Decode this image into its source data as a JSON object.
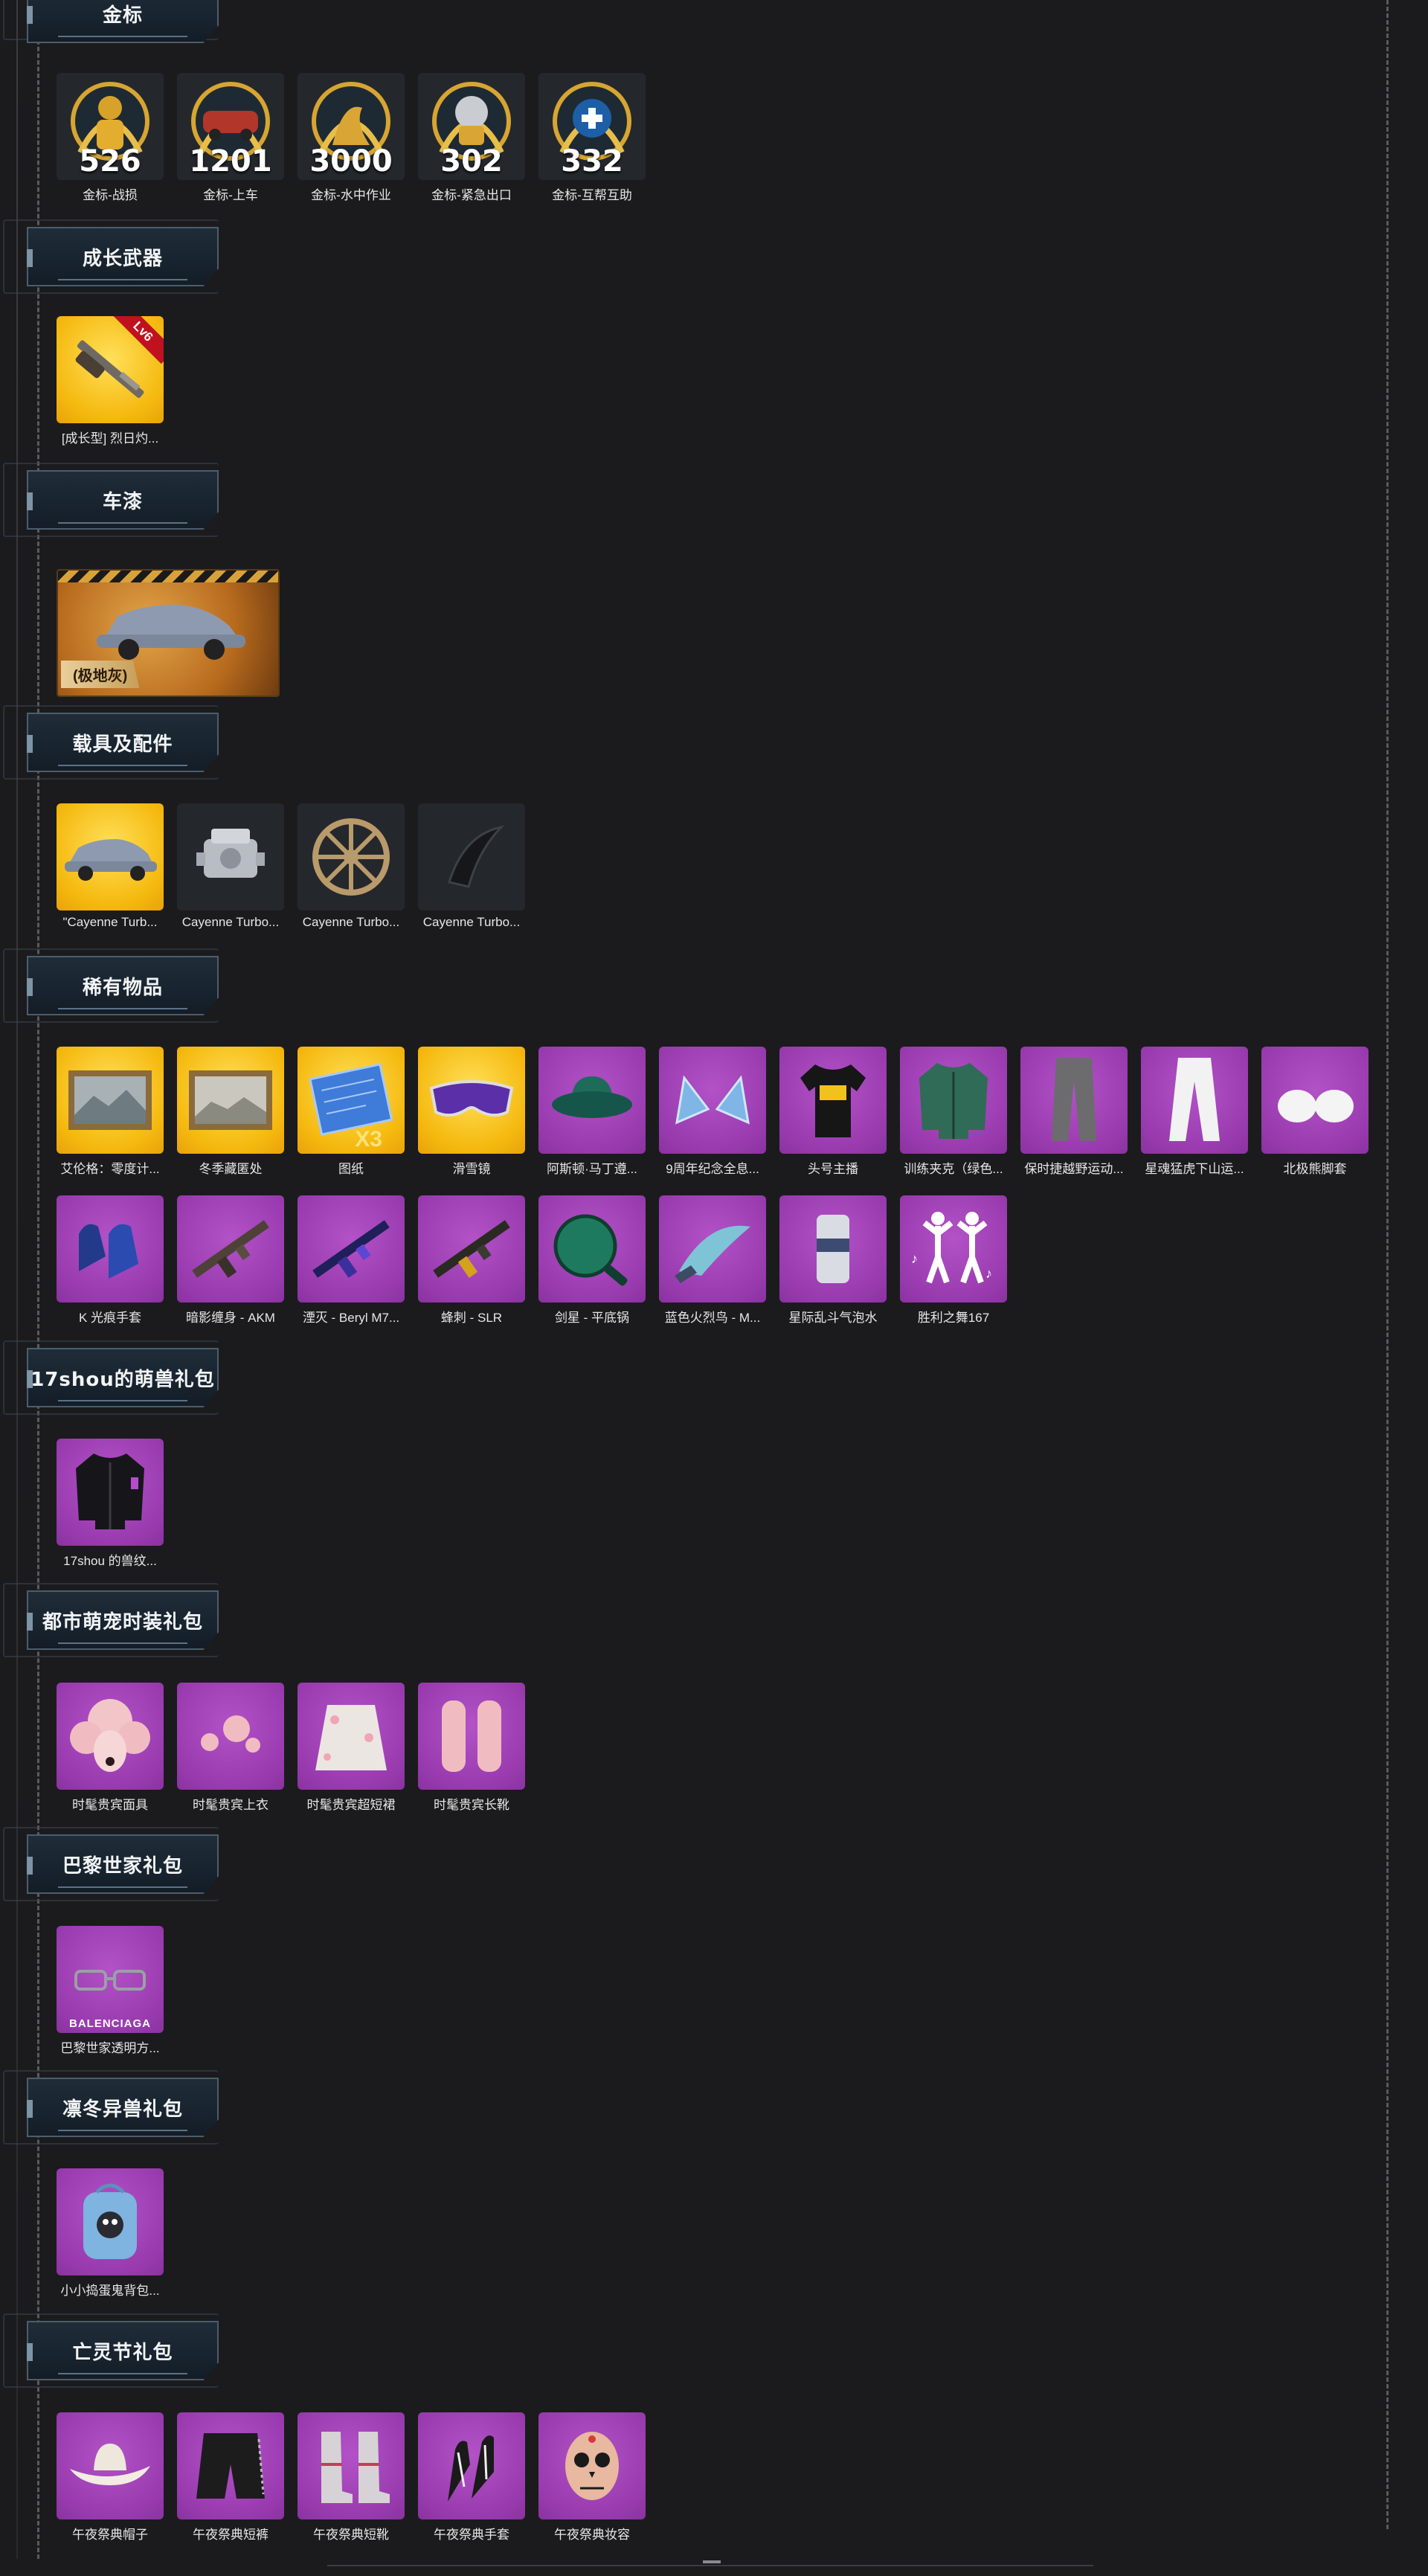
{
  "sections": {
    "gold_medals": {
      "title": "金标",
      "items": [
        {
          "count": "526",
          "label": "金标-战损",
          "icon": "gold-medal-soldier-icon"
        },
        {
          "count": "1201",
          "label": "金标-上车",
          "icon": "gold-medal-car-icon"
        },
        {
          "count": "3000",
          "label": "金标-水中作业",
          "icon": "gold-medal-seal-icon"
        },
        {
          "count": "302",
          "label": "金标-紧急出口",
          "icon": "gold-medal-parachute-icon"
        },
        {
          "count": "332",
          "label": "金标-互帮互助",
          "icon": "gold-medal-medic-icon"
        }
      ]
    },
    "growth_weapons": {
      "title": "成长武器",
      "items": [
        {
          "label": "[成长型] 烈日灼...",
          "badge": "Lv6",
          "icon": "shotgun-icon"
        }
      ]
    },
    "vehicle_skins": {
      "title": "车漆",
      "items": [
        {
          "tag": "(极地灰)",
          "icon": "suv-icon"
        }
      ]
    },
    "vehicles_parts": {
      "title": "载具及配件",
      "items": [
        {
          "label": "\"Cayenne Turb...",
          "icon": "suv-icon",
          "bg": "gold"
        },
        {
          "label": "Cayenne Turbo...",
          "icon": "engine-icon",
          "bg": "dark"
        },
        {
          "label": "Cayenne Turbo...",
          "icon": "wheel-icon",
          "bg": "dark"
        },
        {
          "label": "Cayenne Turbo...",
          "icon": "spoiler-icon",
          "bg": "dark"
        }
      ]
    },
    "rare_items": {
      "title": "稀有物品",
      "row1": [
        {
          "label": "艾伦格：零度计...",
          "icon": "painting-icon",
          "bg": "gold"
        },
        {
          "label": "冬季藏匿处",
          "icon": "painting-icon",
          "bg": "gold"
        },
        {
          "label": "图纸",
          "icon": "blueprint-icon",
          "bg": "gold",
          "extra": "X3"
        },
        {
          "label": "滑雪镜",
          "icon": "goggles-icon",
          "bg": "gold"
        },
        {
          "label": "阿斯顿·马丁遵...",
          "icon": "bucket-hat-icon",
          "bg": "purple"
        },
        {
          "label": "9周年纪念全息...",
          "icon": "cat-ears-icon",
          "bg": "purple"
        },
        {
          "label": "头号主播",
          "icon": "tshirt-icon",
          "bg": "purple"
        },
        {
          "label": "训练夹克（绿色...",
          "icon": "jacket-icon",
          "bg": "purple"
        },
        {
          "label": "保时捷越野运动...",
          "icon": "pants-icon",
          "bg": "purple"
        },
        {
          "label": "星魂猛虎下山运...",
          "icon": "pants-icon",
          "bg": "purple"
        },
        {
          "label": "北极熊脚套",
          "icon": "paw-icon",
          "bg": "purple"
        }
      ],
      "row2": [
        {
          "label": "K 光痕手套",
          "icon": "gloves-icon",
          "bg": "purple"
        },
        {
          "label": "暗影缠身 - AKM",
          "icon": "rifle-icon",
          "bg": "purple"
        },
        {
          "label": "湮灭 - Beryl M7...",
          "icon": "rifle-icon",
          "bg": "purple"
        },
        {
          "label": "蜂刺 - SLR",
          "icon": "rifle-icon",
          "bg": "purple"
        },
        {
          "label": "剑星 - 平底锅",
          "icon": "pan-icon",
          "bg": "purple"
        },
        {
          "label": "蓝色火烈鸟 - M...",
          "icon": "knife-icon",
          "bg": "purple"
        },
        {
          "label": "星际乱斗气泡水",
          "icon": "soda-can-icon",
          "bg": "purple"
        },
        {
          "label": "胜利之舞167",
          "icon": "dance-icon",
          "bg": "purple"
        }
      ]
    },
    "pack_17shou": {
      "title": "17shou的萌兽礼包",
      "items": [
        {
          "label": "17shou 的兽纹...",
          "icon": "jacket-icon",
          "bg": "purple"
        }
      ]
    },
    "pack_urban_pet": {
      "title": "都市萌宠时装礼包",
      "items": [
        {
          "label": "时髦贵宾面具",
          "icon": "poodle-mask-icon",
          "bg": "purple"
        },
        {
          "label": "时髦贵宾上衣",
          "icon": "fur-top-icon",
          "bg": "purple"
        },
        {
          "label": "时髦贵宾超短裙",
          "icon": "fur-skirt-icon",
          "bg": "purple"
        },
        {
          "label": "时髦贵宾长靴",
          "icon": "fur-boots-icon",
          "bg": "purple"
        }
      ]
    },
    "pack_balenciaga": {
      "title": "巴黎世家礼包",
      "items": [
        {
          "label": "巴黎世家透明方...",
          "icon": "glasses-icon",
          "bg": "purple",
          "brand": "BALENCIAGA"
        }
      ]
    },
    "pack_winter": {
      "title": "凛冬异兽礼包",
      "items": [
        {
          "label": "小小捣蛋鬼背包...",
          "icon": "backpack-icon",
          "bg": "purple"
        }
      ]
    },
    "pack_dead": {
      "title": "亡灵节礼包",
      "items": [
        {
          "label": "午夜祭典帽子",
          "icon": "cowboy-hat-icon",
          "bg": "purple"
        },
        {
          "label": "午夜祭典短裤",
          "icon": "shorts-icon",
          "bg": "purple"
        },
        {
          "label": "午夜祭典短靴",
          "icon": "boots-icon",
          "bg": "purple"
        },
        {
          "label": "午夜祭典手套",
          "icon": "skeleton-glove-icon",
          "bg": "purple"
        },
        {
          "label": "午夜祭典妆容",
          "icon": "skull-face-icon",
          "bg": "purple"
        }
      ]
    }
  },
  "colors": {
    "background": "#1b1b1d",
    "rare_purple": "#9a3cb0",
    "legendary_gold": "#f5b90f",
    "header_bg": "#1f2d38"
  }
}
